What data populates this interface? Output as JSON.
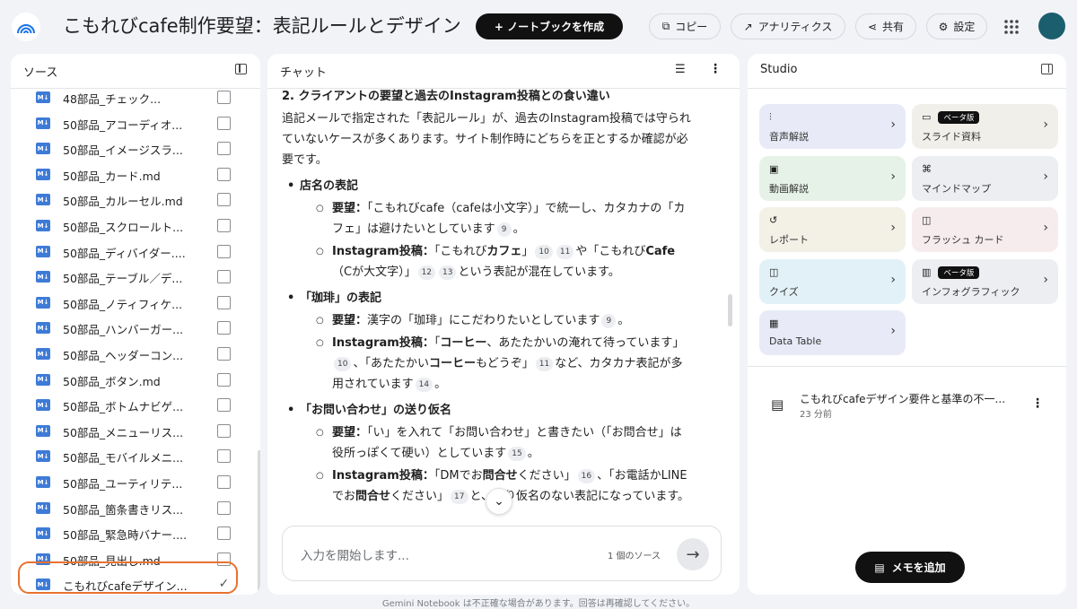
{
  "header": {
    "title": "こもれびcafe制作要望：表記ルールとデザイン指針",
    "create_label": "+ ノートブックを作成",
    "copy_label": "コピー",
    "analytics_label": "アナリティクス",
    "share_label": "共有",
    "settings_label": "設定"
  },
  "sources": {
    "title": "ソース",
    "items": [
      {
        "label": "48部品_チェック..."
      },
      {
        "label": "50部品_アコーディオ..."
      },
      {
        "label": "50部品_イメージスラ..."
      },
      {
        "label": "50部品_カード.md"
      },
      {
        "label": "50部品_カルーセル.md"
      },
      {
        "label": "50部品_スクロールト..."
      },
      {
        "label": "50部品_ディバイダー...."
      },
      {
        "label": "50部品_テーブル／デ..."
      },
      {
        "label": "50部品_ノティフィケ..."
      },
      {
        "label": "50部品_ハンバーガー..."
      },
      {
        "label": "50部品_ヘッダーコン..."
      },
      {
        "label": "50部品_ボタン.md"
      },
      {
        "label": "50部品_ボトムナビゲ..."
      },
      {
        "label": "50部品_メニューリス..."
      },
      {
        "label": "50部品_モバイルメニ..."
      },
      {
        "label": "50部品_ユーティリテ..."
      },
      {
        "label": "50部品_箇条書きリス..."
      },
      {
        "label": "50部品_緊急時バナー...."
      },
      {
        "label": "50部品_見出し.md"
      },
      {
        "label": "こもれびcafeデザイン..."
      }
    ]
  },
  "chat": {
    "title": "チャット",
    "heading": "2. クライアントの要望と過去のInstagram投稿との食い違い",
    "intro": "追記メールで指定された「表記ルール」が、過去のInstagram投稿では守られていないケースが多くあります。サイト制作時にどちらを正とするか確認が必要です。",
    "s1_title": "店名の表記",
    "s1_req_label": "要望：",
    "s1_req_text": "「こもれびcafe（cafeは小文字）」で統一し、カタカナの「カフェ」は避けたいとしています",
    "s1_req_cite": "9",
    "s1_req_end": "。",
    "s1_ig_label": "Instagram投稿：",
    "s1_ig_a": "「こもれび",
    "s1_ig_b": "カフェ",
    "s1_ig_c": "」",
    "s1_ig_cite1": "10",
    "s1_ig_cite2": "11",
    "s1_ig_d": "や「こもれび",
    "s1_ig_e": "Cafe",
    "s1_ig_f": "（Cが大文字）」",
    "s1_ig_cite3": "12",
    "s1_ig_cite4": "13",
    "s1_ig_g": "という表記が混在しています。",
    "s2_title": "「珈琲」の表記",
    "s2_req_label": "要望：",
    "s2_req_text": "漢字の「珈琲」にこだわりたいとしています",
    "s2_req_cite": "9",
    "s2_req_end": "。",
    "s2_ig_label": "Instagram投稿：",
    "s2_ig_a": "「",
    "s2_ig_b": "コーヒー",
    "s2_ig_c": "、あたたかいの淹れて待っています」",
    "s2_ig_cite1": "10",
    "s2_ig_d": "、「あたたかい",
    "s2_ig_e": "コーヒー",
    "s2_ig_f": "もどうぞ」",
    "s2_ig_cite2": "11",
    "s2_ig_g": "など、カタカナ表記が多用されています",
    "s2_ig_cite3": "14",
    "s2_ig_end": "。",
    "s3_title": "「お問い合わせ」の送り仮名",
    "s3_req_label": "要望：",
    "s3_req_text": "「い」を入れて「お問い合わせ」と書きたい（「お問合せ」は役所っぽくて硬い）としています",
    "s3_req_cite": "15",
    "s3_req_end": "。",
    "s3_ig_label": "Instagram投稿：",
    "s3_ig_a": "「DMでお",
    "s3_ig_b": "問合せ",
    "s3_ig_c": "ください」",
    "s3_ig_cite1": "16",
    "s3_ig_d": "、「お電話かLINEでお",
    "s3_ig_e": "問合せ",
    "s3_ig_f": "ください」",
    "s3_ig_cite2": "17",
    "s3_ig_g": "と、送り仮名のない表記になっています。",
    "input_placeholder": "入力を開始します...",
    "source_count": "1 個のソース"
  },
  "studio": {
    "title": "Studio",
    "beta_label": "ベータ版",
    "cards": [
      {
        "label": "音声解説",
        "color": "#e8ebf7"
      },
      {
        "label": "スライド資料",
        "color": "#f1efea"
      },
      {
        "label": "動画解説",
        "color": "#e6f2e8"
      },
      {
        "label": "マインドマップ",
        "color": "#eceef1"
      },
      {
        "label": "レポート",
        "color": "#f3f0e6"
      },
      {
        "label": "フラッシュ カード",
        "color": "#f7eced"
      },
      {
        "label": "クイズ",
        "color": "#e2f1f8"
      },
      {
        "label": "インフォグラフィック",
        "color": "#eceef1"
      },
      {
        "label": "Data Table",
        "color": "#e8ebf7"
      }
    ],
    "note_title": "こもれびcafeデザイン要件と基準の不一...",
    "note_time": "23 分前",
    "add_note_label": "メモを追加"
  },
  "footer_text": "Gemini Notebook は不正確な場合があります。回答は再確認してください。"
}
